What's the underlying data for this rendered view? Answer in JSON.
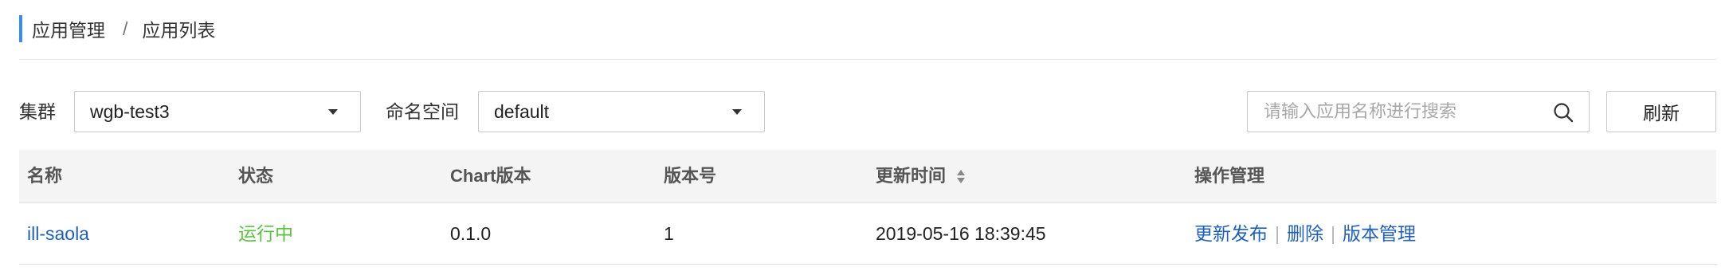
{
  "breadcrumb": {
    "parent": "应用管理",
    "separator": "/",
    "current": "应用列表"
  },
  "filters": {
    "cluster_label": "集群",
    "cluster_value": "wgb-test3",
    "namespace_label": "命名空间",
    "namespace_value": "default"
  },
  "search": {
    "placeholder": "请输入应用名称进行搜索",
    "value": ""
  },
  "refresh_label": "刷新",
  "table": {
    "headers": [
      "名称",
      "状态",
      "Chart版本",
      "版本号",
      "更新时间",
      "操作管理"
    ],
    "rows": [
      {
        "name": "ill-saola",
        "status": "运行中",
        "chart_version": "0.1.0",
        "version": "1",
        "updated": "2019-05-16 18:39:45",
        "actions": [
          "更新发布",
          "删除",
          "版本管理"
        ]
      }
    ]
  },
  "colors": {
    "accent": "#3a8ee6",
    "link": "#1f5fbf",
    "status_running": "#5ac33d"
  },
  "icons": {
    "search": "search-icon",
    "select_caret": "chevron-down-icon",
    "sort": "sort-icon"
  }
}
